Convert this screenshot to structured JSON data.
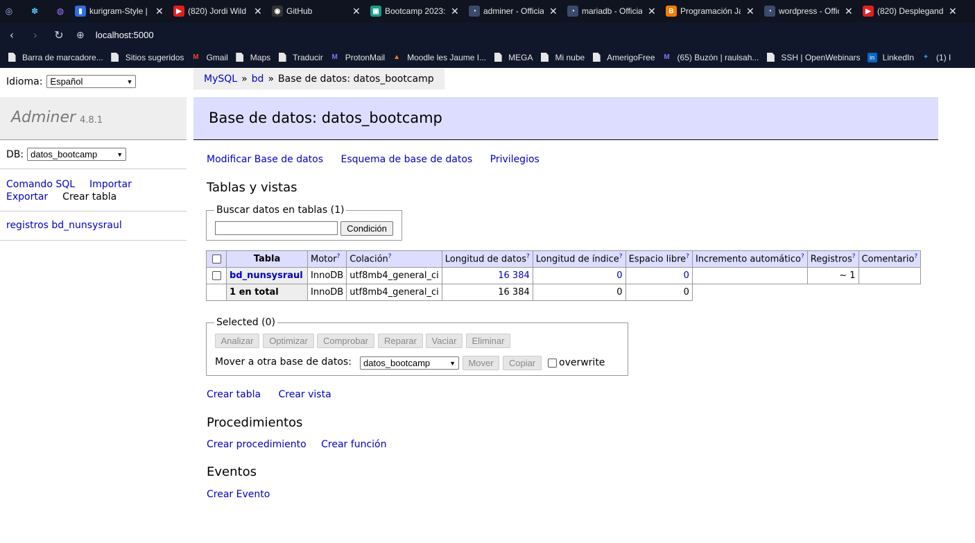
{
  "browser": {
    "tabs": [
      {
        "title": "kurigram-Style |",
        "color": "#2f6de1",
        "glyph": "▮"
      },
      {
        "title": "(820) Jordi Wild |",
        "color": "#e02020",
        "glyph": "▶"
      },
      {
        "title": "GitHub",
        "color": "#333333",
        "glyph": "◉"
      },
      {
        "title": "Bootcamp 2023:",
        "color": "#1a9a8a",
        "glyph": "▣"
      },
      {
        "title": "adminer - Officia",
        "color": "#3a4a6a",
        "glyph": "◔"
      },
      {
        "title": "mariadb - Officia",
        "color": "#3a4a6a",
        "glyph": "◔"
      },
      {
        "title": "Programación Ja",
        "color": "#f57c00",
        "glyph": "B"
      },
      {
        "title": "wordpress - Offic",
        "color": "#3a4a6a",
        "glyph": "◔"
      },
      {
        "title": "(820) Desplegand",
        "color": "#e02020",
        "glyph": "▶"
      }
    ],
    "url": "localhost:5000",
    "bookmarks": [
      {
        "label": "Barra de marcadore...",
        "icon": "document-icon"
      },
      {
        "label": "Sitios sugeridos",
        "icon": "document-icon"
      },
      {
        "label": "Gmail",
        "icon": "gmail-icon"
      },
      {
        "label": "Maps",
        "icon": "document-icon"
      },
      {
        "label": "Traducir",
        "icon": "document-icon"
      },
      {
        "label": "ProtonMail",
        "icon": "protonmail-icon"
      },
      {
        "label": "Moodle les Jaume I...",
        "icon": "moodle-icon"
      },
      {
        "label": "MEGA",
        "icon": "document-icon"
      },
      {
        "label": "Mi nube",
        "icon": "document-icon"
      },
      {
        "label": "AmerigoFree",
        "icon": "document-icon"
      },
      {
        "label": "(65) Buzón | raulsah...",
        "icon": "protonmail-icon"
      },
      {
        "label": "SSH | OpenWebinars",
        "icon": "document-icon"
      },
      {
        "label": "LinkedIn",
        "icon": "linkedin-icon"
      },
      {
        "label": "(1) I",
        "icon": "twitter-icon"
      }
    ]
  },
  "sidebar": {
    "lang_label": "Idioma:",
    "lang_value": "Español",
    "app_name": "Adminer",
    "version": "4.8.1",
    "db_label": "DB:",
    "db_value": "datos_bootcamp",
    "links": {
      "sql": "Comando SQL",
      "import": "Importar",
      "export": "Exportar",
      "create_table": "Crear tabla"
    },
    "tables": [
      "registros bd_nunsysraul"
    ]
  },
  "breadcrumb": {
    "mysql": "MySQL",
    "sep": "»",
    "bd": "bd",
    "current": "Base de datos: datos_bootcamp"
  },
  "title": "Base de datos: datos_bootcamp",
  "actions": {
    "alter": "Modificar Base de datos",
    "schema": "Esquema de base de datos",
    "privileges": "Privilegios"
  },
  "tables_section": {
    "heading": "Tablas y vistas",
    "search_legend": "Buscar datos en tablas (1)",
    "search_value": "",
    "search_button": "Condición",
    "columns": [
      "Tabla",
      "Motor",
      "Colación",
      "Longitud de datos",
      "Longitud de índice",
      "Espacio libre",
      "Incremento automático",
      "Registros",
      "Comentario"
    ],
    "help_mark": "?",
    "rows": [
      {
        "name": "bd_nunsysraul",
        "engine": "InnoDB",
        "collation": "utf8mb4_general_ci",
        "data_length": "16 384",
        "index_length": "0",
        "free": "0",
        "auto_inc": "",
        "rows": "~ 1",
        "comment": ""
      }
    ],
    "total": {
      "name": "1 en total",
      "engine": "InnoDB",
      "collation": "utf8mb4_general_ci",
      "data_length": "16 384",
      "index_length": "0",
      "free": "0"
    }
  },
  "selected": {
    "legend": "Selected (0)",
    "buttons": [
      "Analizar",
      "Optimizar",
      "Comprobar",
      "Reparar",
      "Vaciar",
      "Eliminar"
    ],
    "move_label": "Mover a otra base de datos:",
    "move_db": "datos_bootcamp",
    "move_button": "Mover",
    "copy_button": "Copiar",
    "overwrite": "overwrite"
  },
  "bottom_links": {
    "create_table": "Crear tabla",
    "create_view": "Crear vista"
  },
  "procedures": {
    "heading": "Procedimientos",
    "create_proc": "Crear procedimiento",
    "create_func": "Crear función"
  },
  "events": {
    "heading": "Eventos",
    "create_event": "Crear Evento"
  }
}
